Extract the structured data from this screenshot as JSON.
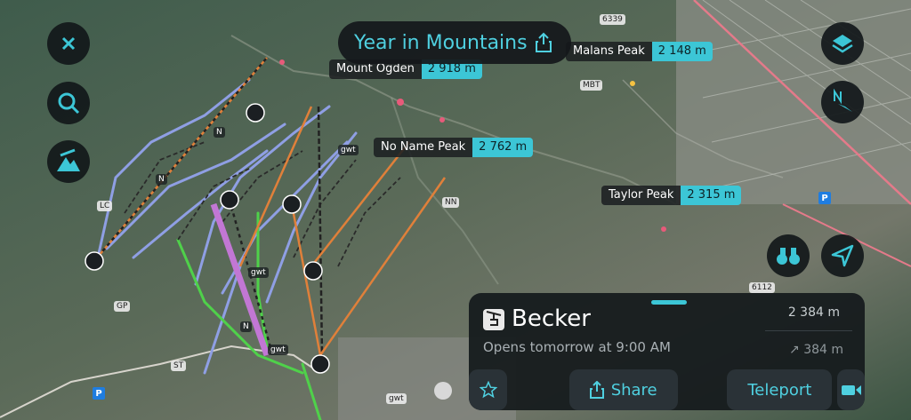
{
  "header": {
    "title": "Year in Mountains"
  },
  "peaks": [
    {
      "name": "Mount Ogden",
      "elevation": "2 918 m"
    },
    {
      "name": "Malans Peak",
      "elevation": "2 148 m"
    },
    {
      "name": "No Name Peak",
      "elevation": "2 762 m"
    },
    {
      "name": "Taylor Peak",
      "elevation": "2 315 m"
    }
  ],
  "map_labels": {
    "n1": "N",
    "n2": "N",
    "n3": "N",
    "lc": "LC",
    "gp": "GP",
    "st": "ST",
    "gwt1": "gwt",
    "gwt2": "gwt",
    "gwt3": "gwt",
    "gwt4": "gwt",
    "nn": "NN",
    "mbt": "MBT",
    "road1": "6339",
    "road2": "6112",
    "parking1": "P",
    "parking2": "P"
  },
  "lift_panel": {
    "name": "Becker",
    "status": "Opens tomorrow at 9:00 AM",
    "top_elevation": "2 384 m",
    "vertical": "384 m",
    "share_label": "Share",
    "teleport_label": "Teleport"
  },
  "icons": {
    "close": "close-icon",
    "search": "search-icon",
    "terrain": "terrain-icon",
    "layers": "layers-icon",
    "compass": "compass-icon",
    "binoculars": "binoculars-icon",
    "locate": "location-arrow-icon",
    "favorite": "star-icon",
    "share": "share-icon",
    "camera": "video-camera-icon"
  },
  "colors": {
    "accent": "#3cc6d6",
    "panel": "#161b1e"
  }
}
